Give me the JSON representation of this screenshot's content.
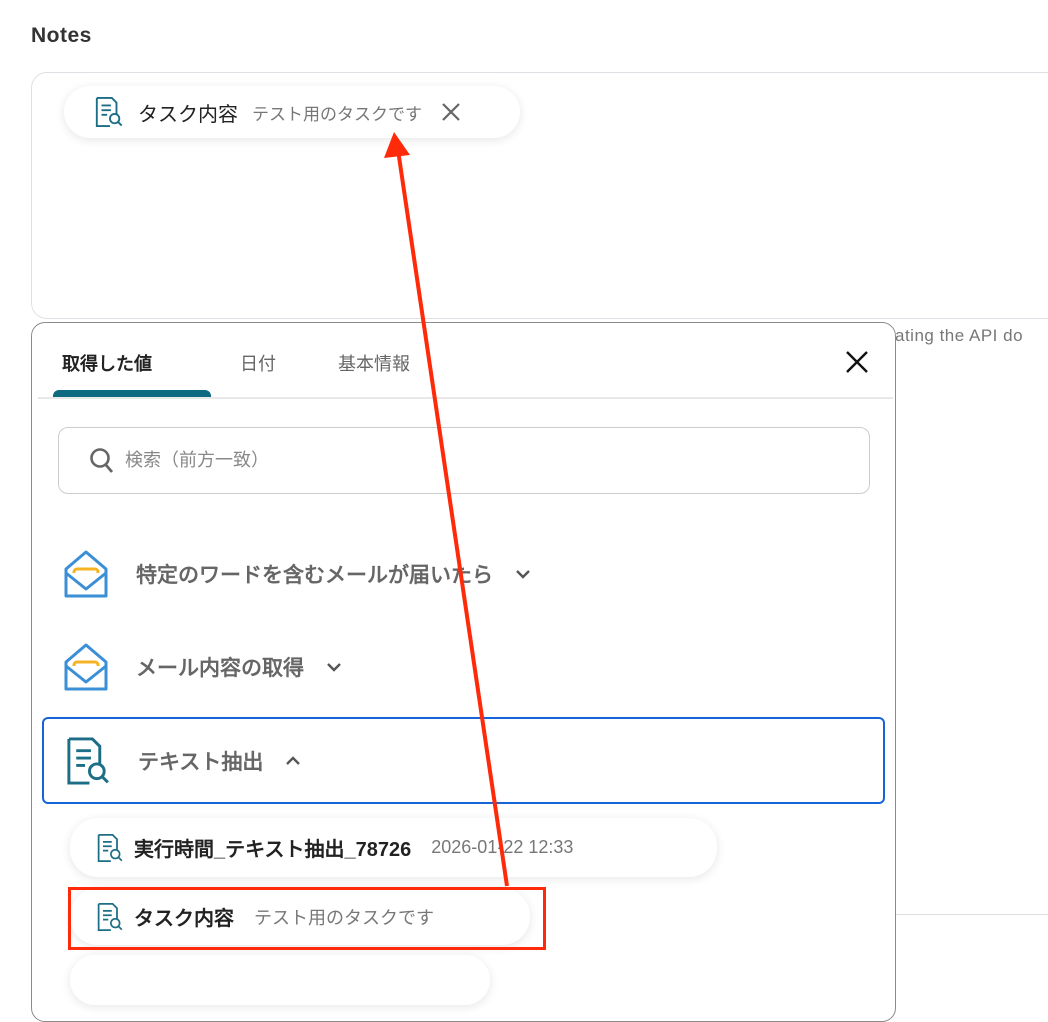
{
  "notes": {
    "label": "Notes",
    "chip": {
      "label": "タスク内容",
      "value": "テスト用のタスクです",
      "icon": "document-search-icon"
    },
    "helper_text": "ating the API do"
  },
  "panel": {
    "tabs": [
      {
        "label": "取得した値",
        "active": true
      },
      {
        "label": "日付",
        "active": false
      },
      {
        "label": "基本情報",
        "active": false
      }
    ],
    "search_placeholder": "検索（前方一致）",
    "groups": [
      {
        "label": "特定のワードを含むメールが届いたら",
        "icon": "mail-icon",
        "expanded": false
      },
      {
        "label": "メール内容の取得",
        "icon": "mail-icon",
        "expanded": false
      },
      {
        "label": "テキスト抽出",
        "icon": "document-search-icon",
        "expanded": true
      }
    ],
    "items": [
      {
        "label": "実行時間_テキスト抽出_78726",
        "value": "2026-01-22 12:33"
      },
      {
        "label": "タスク内容",
        "value": "テスト用のタスクです"
      }
    ]
  },
  "colors": {
    "accent": "#0e6a80",
    "selected_border": "#1565d8",
    "annotation": "#ff2a0a"
  }
}
